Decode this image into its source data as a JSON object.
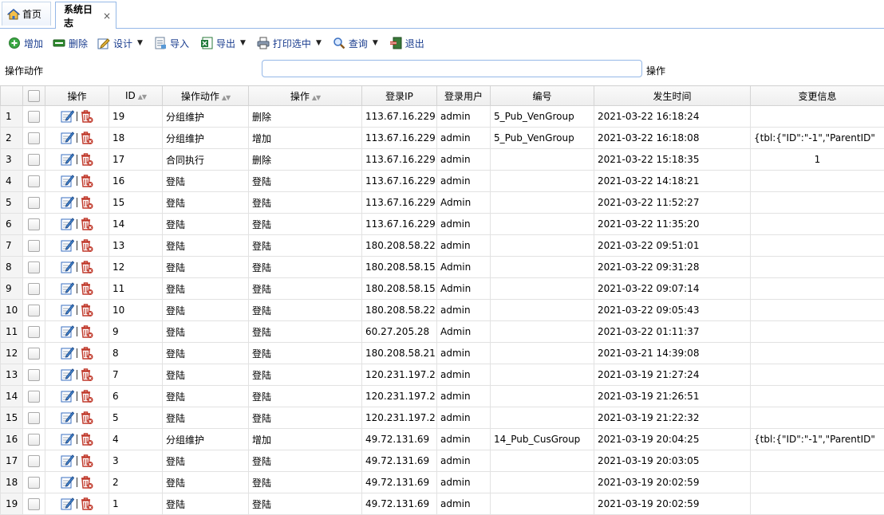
{
  "tabs": [
    {
      "label": "首页",
      "icon": "home-icon"
    },
    {
      "label": "系统日志",
      "close": "×"
    }
  ],
  "toolbar": {
    "add": "增加",
    "delete": "删除",
    "design": "设计",
    "import": "导入",
    "export": "导出",
    "print": "打印选中",
    "query": "查询",
    "exit": "退出"
  },
  "search": {
    "label": "操作动作",
    "value": "",
    "suffix": "操作"
  },
  "grid": {
    "headers": {
      "ops": "操作",
      "id": "ID",
      "action": "操作动作",
      "operation": "操作",
      "ip": "登录IP",
      "user": "登录用户",
      "code": "编号",
      "time": "发生时间",
      "change": "变更信息"
    },
    "rows": [
      {
        "n": "1",
        "id": "19",
        "action": "分组维护",
        "op": "删除",
        "ip": "113.67.16.229",
        "user": "admin",
        "code": "5_Pub_VenGroup",
        "time": "2021-03-22 16:18:24",
        "change": ""
      },
      {
        "n": "2",
        "id": "18",
        "action": "分组维护",
        "op": "增加",
        "ip": "113.67.16.229",
        "user": "admin",
        "code": "5_Pub_VenGroup",
        "time": "2021-03-22 16:18:08",
        "change": "{tbl:{\"ID\":\"-1\",\"ParentID\""
      },
      {
        "n": "3",
        "id": "17",
        "action": "合同执行",
        "op": "删除",
        "ip": "113.67.16.229",
        "user": "admin",
        "code": "",
        "time": "2021-03-22 15:18:35",
        "change": "1"
      },
      {
        "n": "4",
        "id": "16",
        "action": "登陆",
        "op": "登陆",
        "ip": "113.67.16.229",
        "user": "admin",
        "code": "",
        "time": "2021-03-22 14:18:21",
        "change": ""
      },
      {
        "n": "5",
        "id": "15",
        "action": "登陆",
        "op": "登陆",
        "ip": "113.67.16.229",
        "user": "Admin",
        "code": "",
        "time": "2021-03-22 11:52:27",
        "change": ""
      },
      {
        "n": "6",
        "id": "14",
        "action": "登陆",
        "op": "登陆",
        "ip": "113.67.16.229",
        "user": "admin",
        "code": "",
        "time": "2021-03-22 11:35:20",
        "change": ""
      },
      {
        "n": "7",
        "id": "13",
        "action": "登陆",
        "op": "登陆",
        "ip": "180.208.58.22",
        "user": "admin",
        "code": "",
        "time": "2021-03-22 09:51:01",
        "change": ""
      },
      {
        "n": "8",
        "id": "12",
        "action": "登陆",
        "op": "登陆",
        "ip": "180.208.58.15",
        "user": "Admin",
        "code": "",
        "time": "2021-03-22 09:31:28",
        "change": ""
      },
      {
        "n": "9",
        "id": "11",
        "action": "登陆",
        "op": "登陆",
        "ip": "180.208.58.15",
        "user": "Admin",
        "code": "",
        "time": "2021-03-22 09:07:14",
        "change": ""
      },
      {
        "n": "10",
        "id": "10",
        "action": "登陆",
        "op": "登陆",
        "ip": "180.208.58.22",
        "user": "admin",
        "code": "",
        "time": "2021-03-22 09:05:43",
        "change": ""
      },
      {
        "n": "11",
        "id": "9",
        "action": "登陆",
        "op": "登陆",
        "ip": "60.27.205.28",
        "user": "Admin",
        "code": "",
        "time": "2021-03-22 01:11:37",
        "change": ""
      },
      {
        "n": "12",
        "id": "8",
        "action": "登陆",
        "op": "登陆",
        "ip": "180.208.58.21",
        "user": "admin",
        "code": "",
        "time": "2021-03-21 14:39:08",
        "change": ""
      },
      {
        "n": "13",
        "id": "7",
        "action": "登陆",
        "op": "登陆",
        "ip": "120.231.197.2",
        "user": "admin",
        "code": "",
        "time": "2021-03-19 21:27:24",
        "change": ""
      },
      {
        "n": "14",
        "id": "6",
        "action": "登陆",
        "op": "登陆",
        "ip": "120.231.197.2",
        "user": "admin",
        "code": "",
        "time": "2021-03-19 21:26:51",
        "change": ""
      },
      {
        "n": "15",
        "id": "5",
        "action": "登陆",
        "op": "登陆",
        "ip": "120.231.197.2",
        "user": "admin",
        "code": "",
        "time": "2021-03-19 21:22:32",
        "change": ""
      },
      {
        "n": "16",
        "id": "4",
        "action": "分组维护",
        "op": "增加",
        "ip": "49.72.131.69",
        "user": "admin",
        "code": "14_Pub_CusGroup",
        "time": "2021-03-19 20:04:25",
        "change": "{tbl:{\"ID\":\"-1\",\"ParentID\""
      },
      {
        "n": "17",
        "id": "3",
        "action": "登陆",
        "op": "登陆",
        "ip": "49.72.131.69",
        "user": "admin",
        "code": "",
        "time": "2021-03-19 20:03:05",
        "change": ""
      },
      {
        "n": "18",
        "id": "2",
        "action": "登陆",
        "op": "登陆",
        "ip": "49.72.131.69",
        "user": "admin",
        "code": "",
        "time": "2021-03-19 20:02:59",
        "change": ""
      },
      {
        "n": "19",
        "id": "1",
        "action": "登陆",
        "op": "登陆",
        "ip": "49.72.131.69",
        "user": "admin",
        "code": "",
        "time": "2021-03-19 20:02:59",
        "change": ""
      }
    ]
  }
}
